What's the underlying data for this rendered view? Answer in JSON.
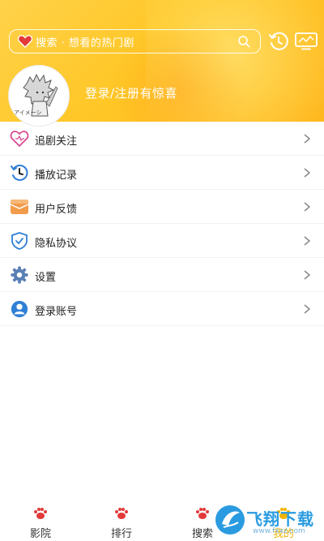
{
  "header": {
    "search_placeholder": "搜索 · 想看的热门剧",
    "login_prompt": "登录/注册有惊喜",
    "avatar_caption": "アイメーシ"
  },
  "menu": {
    "items": [
      {
        "label": "追剧关注",
        "icon": "heart-outline-icon"
      },
      {
        "label": "播放记录",
        "icon": "history-icon"
      },
      {
        "label": "用户反馈",
        "icon": "envelope-icon"
      },
      {
        "label": "隐私协议",
        "icon": "shield-check-icon"
      },
      {
        "label": "设置",
        "icon": "gear-icon"
      },
      {
        "label": "登录账号",
        "icon": "user-icon"
      }
    ]
  },
  "tabbar": {
    "tabs": [
      {
        "label": "影院",
        "active": false
      },
      {
        "label": "排行",
        "active": false
      },
      {
        "label": "搜索",
        "active": false
      },
      {
        "label": "我的",
        "active": true
      }
    ]
  },
  "watermark": {
    "text": "飞翔下载",
    "domain": "www.fxxz.com"
  },
  "colors": {
    "header_yellow": "#ffc727",
    "accent_blue": "#2f7fd6",
    "tab_icon_red": "#e23a3a",
    "active_tab": "#f0b400"
  }
}
